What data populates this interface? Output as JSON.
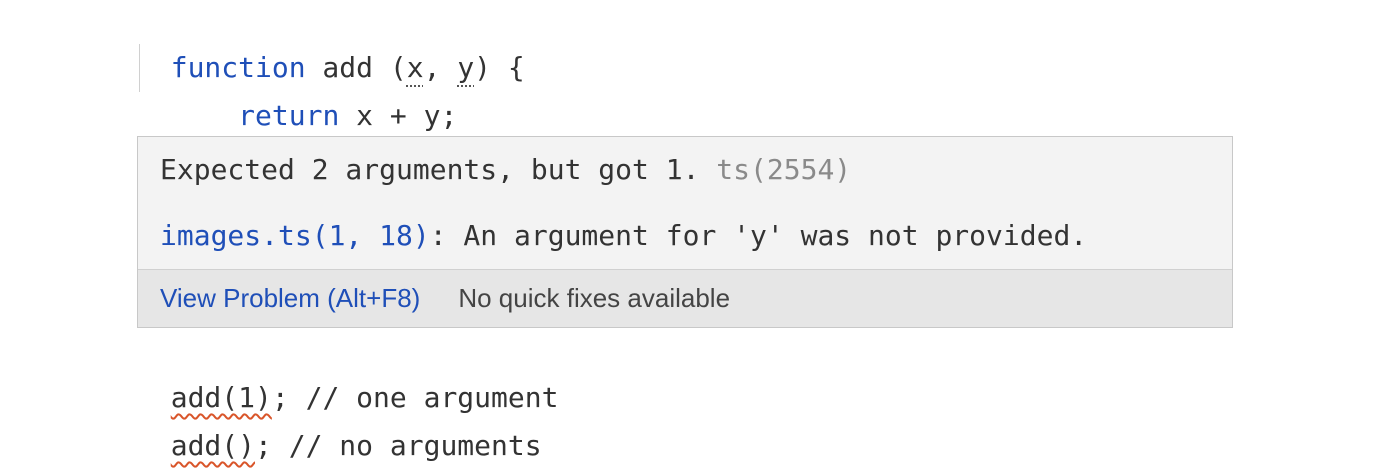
{
  "code": {
    "line1": {
      "keyword": "function",
      "name": " add (",
      "param_x": "x",
      "comma": ", ",
      "param_y": "y",
      "close": ") {"
    },
    "line2": {
      "indent": "    ",
      "keyword": "return",
      "expr": " x + y;"
    },
    "line3": "}",
    "line4": {
      "call": "add(1)",
      "rest": "; // one argument"
    },
    "line5": {
      "call": "add()",
      "rest": "; // no arguments"
    }
  },
  "hover": {
    "message": "Expected 2 arguments, but got 1. ",
    "code_ref": "ts(2554)",
    "related_location": "images.ts(1, 18)",
    "related_message": ": An argument for 'y' was not provided.",
    "view_problem": "View Problem (Alt+F8)",
    "no_quick_fixes": "No quick fixes available"
  },
  "colors": {
    "keyword": "#1f4fb8",
    "error_squiggle": "#d9552a",
    "hover_bg": "#f3f3f3",
    "footer_bg": "#e6e6e6"
  }
}
